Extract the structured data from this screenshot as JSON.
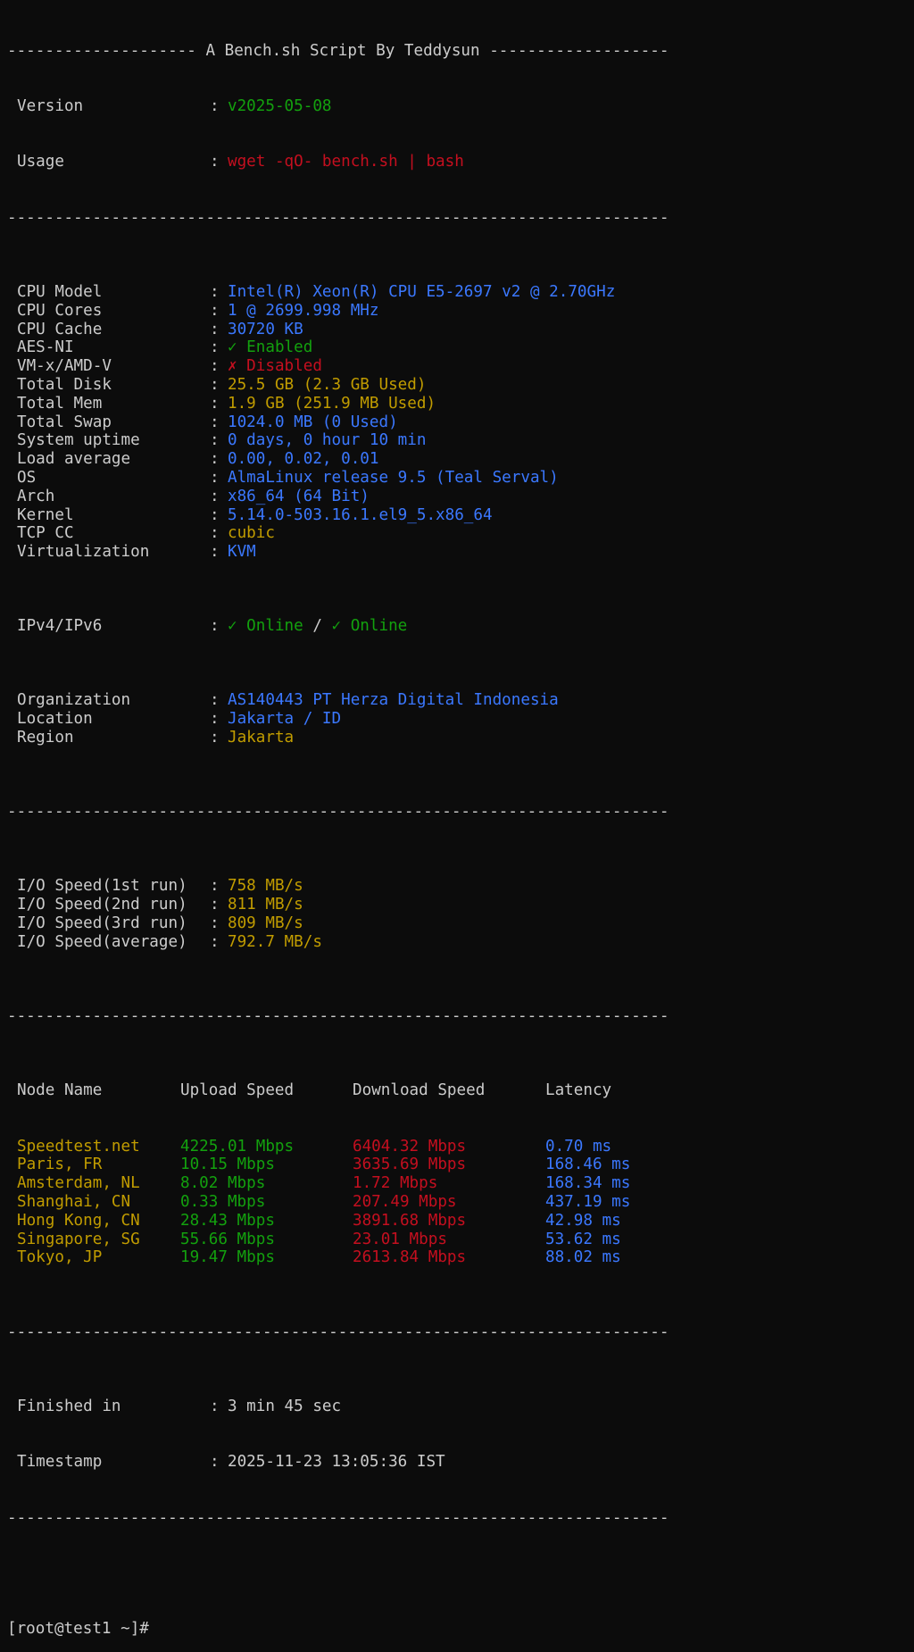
{
  "header": {
    "banner": "-------------------- A Bench.sh Script By Teddysun -------------------",
    "version_label": "Version",
    "version_value": "v2025-05-08",
    "usage_label": "Usage",
    "usage_value": "wget -qO- bench.sh | bash"
  },
  "rule": "----------------------------------------------------------------------",
  "separator": ": ",
  "system": [
    {
      "key": "CPU Model",
      "value": "Intel(R) Xeon(R) CPU E5-2697 v2 @ 2.70GHz",
      "color": "#3b78ff"
    },
    {
      "key": "CPU Cores",
      "value": "1 @ 2699.998 MHz",
      "color": "#3b78ff"
    },
    {
      "key": "CPU Cache",
      "value": "30720 KB",
      "color": "#3b78ff"
    },
    {
      "key": "AES-NI",
      "value": "✓ Enabled",
      "color": "#13a10e"
    },
    {
      "key": "VM-x/AMD-V",
      "value": "✗ Disabled",
      "color": "#c50f1f"
    },
    {
      "key": "Total Disk",
      "value": "25.5 GB (2.3 GB Used)",
      "color": "#c19c00"
    },
    {
      "key": "Total Mem",
      "value": "1.9 GB (251.9 MB Used)",
      "color": "#c19c00"
    },
    {
      "key": "Total Swap",
      "value": "1024.0 MB (0 Used)",
      "color": "#3b78ff"
    },
    {
      "key": "System uptime",
      "value": "0 days, 0 hour 10 min",
      "color": "#3b78ff"
    },
    {
      "key": "Load average",
      "value": "0.00, 0.02, 0.01",
      "color": "#3b78ff"
    },
    {
      "key": "OS",
      "value": "AlmaLinux release 9.5 (Teal Serval)",
      "color": "#3b78ff"
    },
    {
      "key": "Arch",
      "value": "x86_64 (64 Bit)",
      "color": "#3b78ff"
    },
    {
      "key": "Kernel",
      "value": "5.14.0-503.16.1.el9_5.x86_64",
      "color": "#3b78ff"
    },
    {
      "key": "TCP CC",
      "value": "cubic",
      "color": "#c19c00"
    },
    {
      "key": "Virtualization",
      "value": "KVM",
      "color": "#3b78ff"
    }
  ],
  "ip": {
    "key": "IPv4/IPv6",
    "v4": "✓ Online",
    "slash": " / ",
    "v6": "✓ Online"
  },
  "geo": [
    {
      "key": "Organization",
      "value": "AS140443 PT Herza Digital Indonesia",
      "color": "#3b78ff"
    },
    {
      "key": "Location",
      "value": "Jakarta / ID",
      "color": "#3b78ff"
    },
    {
      "key": "Region",
      "value": "Jakarta",
      "color": "#c19c00"
    }
  ],
  "io": [
    {
      "key": "I/O Speed(1st run)",
      "value": "758 MB/s"
    },
    {
      "key": "I/O Speed(2nd run)",
      "value": "811 MB/s"
    },
    {
      "key": "I/O Speed(3rd run)",
      "value": "809 MB/s"
    },
    {
      "key": "I/O Speed(average)",
      "value": "792.7 MB/s"
    }
  ],
  "speedtest": {
    "headers": [
      "Node Name",
      "Upload Speed",
      "Download Speed",
      "Latency"
    ],
    "rows": [
      {
        "node": "Speedtest.net",
        "up": "4225.01 Mbps",
        "down": "6404.32 Mbps",
        "lat": "0.70 ms"
      },
      {
        "node": "Paris, FR",
        "up": "10.15 Mbps",
        "down": "3635.69 Mbps",
        "lat": "168.46 ms"
      },
      {
        "node": "Amsterdam, NL",
        "up": "8.02 Mbps",
        "down": "1.72 Mbps",
        "lat": "168.34 ms"
      },
      {
        "node": "Shanghai, CN",
        "up": "0.33 Mbps",
        "down": "207.49 Mbps",
        "lat": "437.19 ms"
      },
      {
        "node": "Hong Kong, CN",
        "up": "28.43 Mbps",
        "down": "3891.68 Mbps",
        "lat": "42.98 ms"
      },
      {
        "node": "Singapore, SG",
        "up": "55.66 Mbps",
        "down": "23.01 Mbps",
        "lat": "53.62 ms"
      },
      {
        "node": "Tokyo, JP",
        "up": "19.47 Mbps",
        "down": "2613.84 Mbps",
        "lat": "88.02 ms"
      }
    ]
  },
  "footer": {
    "finished_label": "Finished in",
    "finished_value": "3 min 45 sec",
    "timestamp_label": "Timestamp",
    "timestamp_value": "2025-11-23 13:05:36 IST"
  },
  "prompt": "[root@test1 ~]#"
}
